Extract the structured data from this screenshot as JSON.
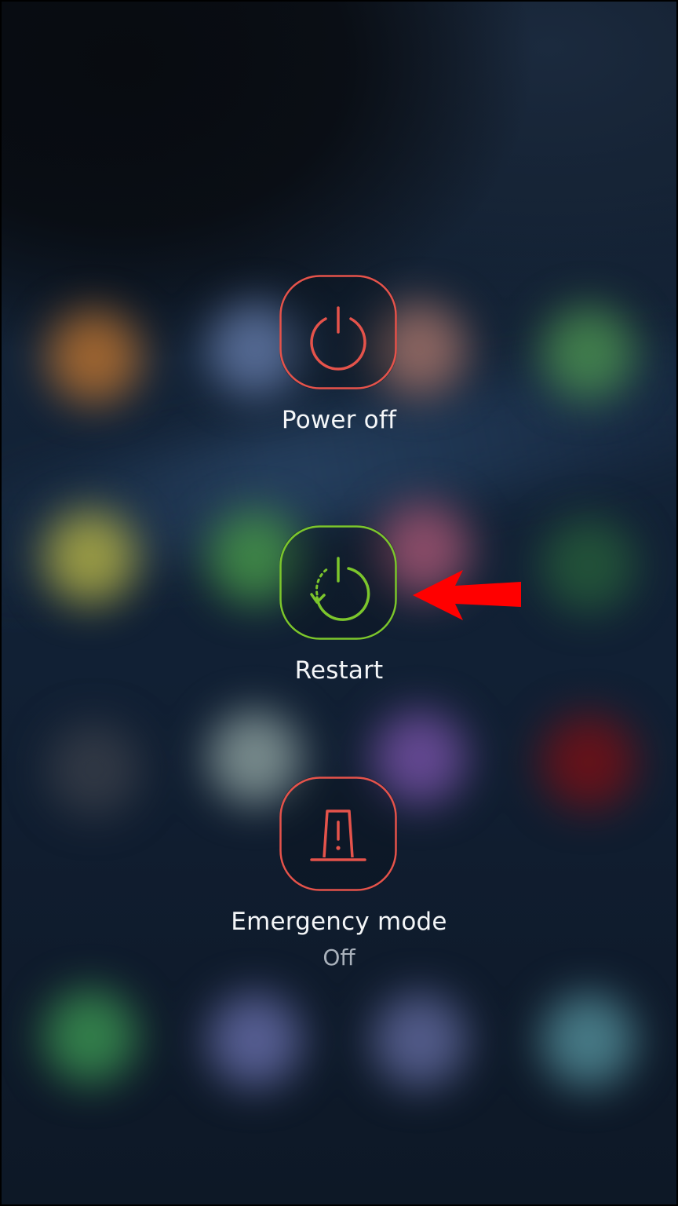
{
  "power_menu": {
    "power_off": {
      "label": "Power off",
      "icon": "power-icon",
      "accent": "#e5534b"
    },
    "restart": {
      "label": "Restart",
      "icon": "restart-icon",
      "accent": "#7cc62c"
    },
    "emergency_mode": {
      "label": "Emergency mode",
      "status": "Off",
      "icon": "emergency-light-icon",
      "accent": "#e5534b"
    }
  },
  "annotation": {
    "icon": "red-arrow-pointer",
    "color": "#ff0000"
  }
}
